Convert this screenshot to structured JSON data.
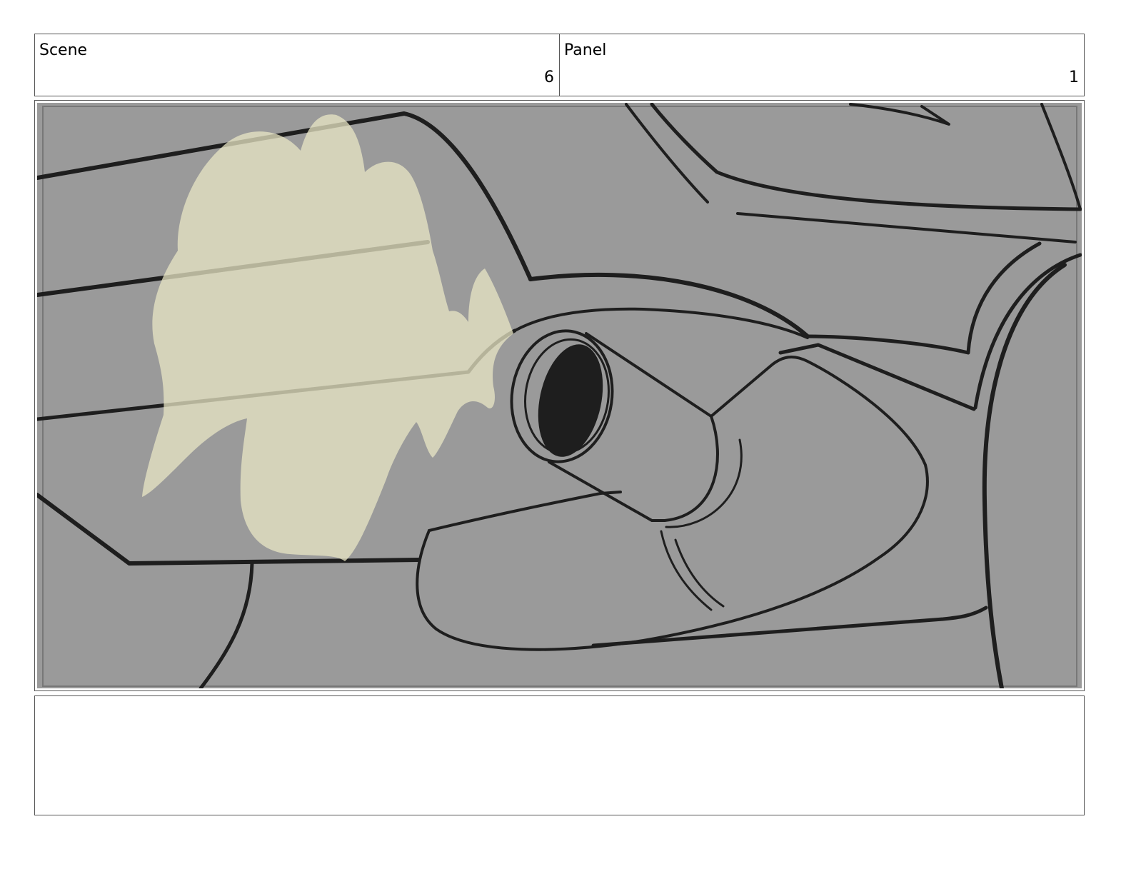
{
  "header": {
    "scene_label": "Scene",
    "scene_number": "6",
    "panel_label": "Panel",
    "panel_number": "1"
  },
  "notes": {
    "text": ""
  },
  "colors": {
    "panel_background": "#9a9a9a",
    "ink": "#1e1e1e",
    "highlight": "#d2d0bb"
  }
}
